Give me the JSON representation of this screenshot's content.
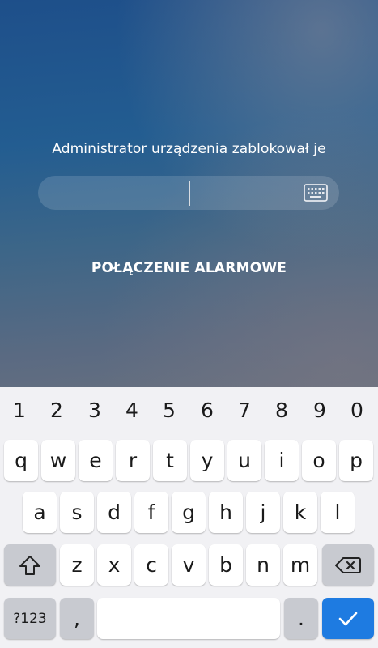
{
  "lockscreen": {
    "message": "Administrator urządzenia zablokował je",
    "emergency_call": "POŁĄCZENIE ALARMOWE"
  },
  "keyboard": {
    "number_row": [
      "1",
      "2",
      "3",
      "4",
      "5",
      "6",
      "7",
      "8",
      "9",
      "0"
    ],
    "row1": [
      "q",
      "w",
      "e",
      "r",
      "t",
      "y",
      "u",
      "i",
      "o",
      "p"
    ],
    "row2": [
      "a",
      "s",
      "d",
      "f",
      "g",
      "h",
      "j",
      "k",
      "l"
    ],
    "row3": [
      "z",
      "x",
      "c",
      "v",
      "b",
      "n",
      "m"
    ],
    "symbols_key": "?123",
    "comma_key": ",",
    "period_key": ".",
    "icons": {
      "shift": "shift-arrow-icon",
      "backspace": "backspace-icon",
      "enter": "checkmark-icon",
      "keyboard_toggle": "keyboard-icon"
    }
  },
  "colors": {
    "accent_enter": "#1e7be1",
    "keyboard_bg": "#f1f1f4",
    "special_key": "#c8cad0"
  }
}
